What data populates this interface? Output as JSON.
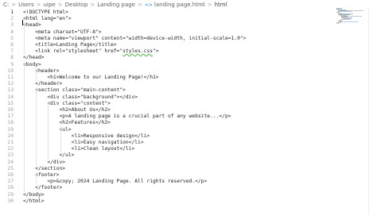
{
  "breadcrumb": {
    "items": [
      "C:",
      "Users",
      "uipe",
      "Desktop",
      "Landing page",
      "landing page.html",
      "html"
    ],
    "separator": ">"
  },
  "editor": {
    "active_line": 1,
    "lines": [
      "<!DOCTYPE html>",
      "<html lang=\"en\">",
      "<head>",
      "    <meta charset=\"UTF-8\">",
      "    <meta name=\"viewport\" content=\"width=device-width, initial-scale=1.0\">",
      "    <title>Landing Page</title>",
      "    <link rel=\"stylesheet\" href=\"styles.css\">",
      "</head>",
      "<body>",
      "    <header>",
      "        <h1>Welcome to our Landing Page!</h1>",
      "    </header>",
      "    <section class=\"main-content\">",
      "        <div class=\"background\"></div>",
      "        <div class=\"content\">",
      "            <h2>About Us</h2>",
      "            <p>A landing page is a crucial part of any website...</p>",
      "            <h2>Features</h2>",
      "            <ul>",
      "                <li>Responsive design</li>",
      "                <li>Easy navigation</li>",
      "                <li>Clean layout</li>",
      "            </ul>",
      "        </div>",
      "    </section>",
      "    <footer>",
      "        <p>&copy; 2024 Landing Page. All rights reserved.</p>",
      "    </footer>",
      "</body>",
      "</html>"
    ]
  },
  "colors": {
    "text": "#1f1f1f",
    "line_number": "#9e9e9e",
    "squiggle": "#52a84a",
    "icon": "#1e88e5"
  }
}
